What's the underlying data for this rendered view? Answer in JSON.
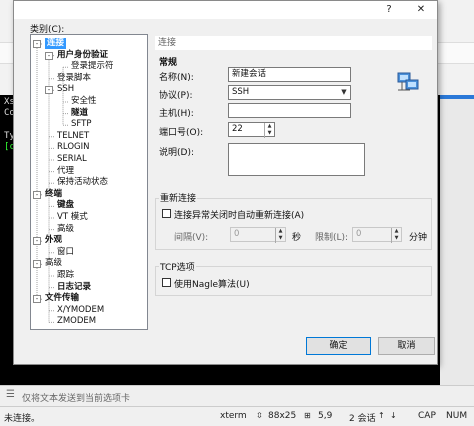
{
  "background": {
    "term_lines": [
      "Xsh",
      "Cop",
      "Typ",
      "[c:"
    ],
    "send_placeholder": "仅将文本发送到当前选项卡",
    "status": {
      "left": "未连接。",
      "term": "xterm",
      "size": "88x25",
      "pos": "5,9",
      "sessions": "2 会话",
      "caps": "CAP",
      "num": "NUM"
    }
  },
  "dialog": {
    "category_label": "类别(C):",
    "tree": [
      {
        "label": "连接",
        "level": 0,
        "bold": true,
        "selected": true,
        "expander": "-"
      },
      {
        "label": "用户身份验证",
        "level": 1,
        "bold": true,
        "expander": "-"
      },
      {
        "label": "登录提示符",
        "level": 2
      },
      {
        "label": "登录脚本",
        "level": 1
      },
      {
        "label": "SSH",
        "level": 1,
        "expander": "-"
      },
      {
        "label": "安全性",
        "level": 2
      },
      {
        "label": "隧道",
        "level": 2,
        "bold": true
      },
      {
        "label": "SFTP",
        "level": 2
      },
      {
        "label": "TELNET",
        "level": 1
      },
      {
        "label": "RLOGIN",
        "level": 1
      },
      {
        "label": "SERIAL",
        "level": 1
      },
      {
        "label": "代理",
        "level": 1
      },
      {
        "label": "保持活动状态",
        "level": 1
      },
      {
        "label": "终端",
        "level": 0,
        "bold": true,
        "expander": "-"
      },
      {
        "label": "键盘",
        "level": 1,
        "bold": true
      },
      {
        "label": "VT 模式",
        "level": 1
      },
      {
        "label": "高级",
        "level": 1
      },
      {
        "label": "外观",
        "level": 0,
        "bold": true,
        "expander": "-"
      },
      {
        "label": "窗口",
        "level": 1
      },
      {
        "label": "高级",
        "level": 0,
        "expander": "-"
      },
      {
        "label": "跟踪",
        "level": 1
      },
      {
        "label": "日志记录",
        "level": 1,
        "bold": true
      },
      {
        "label": "文件传输",
        "level": 0,
        "bold": true,
        "expander": "-"
      },
      {
        "label": "X/YMODEM",
        "level": 1
      },
      {
        "label": "ZMODEM",
        "level": 1
      }
    ],
    "panel_title": "连接",
    "general": {
      "title": "常规",
      "name_label": "名称(N):",
      "name_value": "新建会话",
      "protocol_label": "协议(P):",
      "protocol_value": "SSH",
      "host_label": "主机(H):",
      "host_value": "",
      "port_label": "端口号(O):",
      "port_value": "22",
      "desc_label": "说明(D):",
      "desc_value": ""
    },
    "reconnect": {
      "title": "重新连接",
      "auto_label": "连接异常关闭时自动重新连接(A)",
      "interval_label": "间隔(V):",
      "interval_value": "0",
      "sec_unit": "秒",
      "limit_label": "限制(L):",
      "limit_value": "0",
      "min_unit": "分钟"
    },
    "tcp": {
      "title": "TCP选项",
      "nagle_label": "使用Nagle算法(U)"
    },
    "ok_label": "确定",
    "cancel_label": "取消",
    "title_buttons": {
      "help": "?",
      "close": "✕"
    }
  }
}
